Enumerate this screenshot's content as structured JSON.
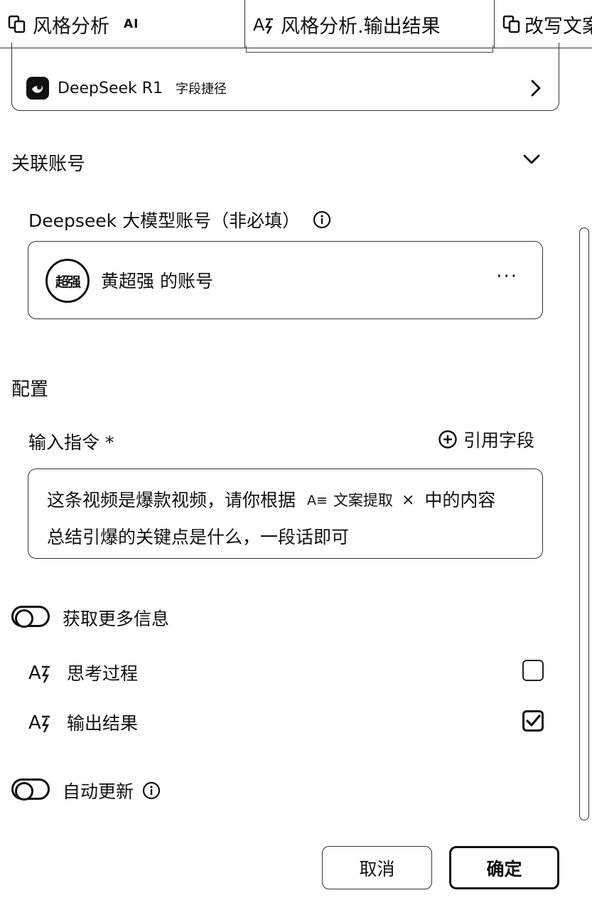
{
  "tabs": [
    {
      "label": "风格分析",
      "badge": "AI",
      "icon": "copy-icon"
    },
    {
      "label": "风格分析.输出结果",
      "icon": "ai-text-icon",
      "active": true
    },
    {
      "label": "改写文案",
      "icon": "copy-icon"
    }
  ],
  "model": {
    "name": "DeepSeek R1",
    "shortcut": "字段捷径",
    "logo": "deepseek-logo"
  },
  "linked_account": {
    "section_title": "关联账号",
    "field_label": "Deepseek 大模型账号（非必填）",
    "avatar_text": "超强",
    "account_name": "黄超强 的账号",
    "more": "···"
  },
  "config": {
    "section_title": "配置",
    "instruction_label": "输入指令 *",
    "ref_field_label": "引用字段",
    "instruction_part1": "这条视频是爆款视频，请你根据",
    "chip_icon": "A≡",
    "chip_label": "文案提取",
    "chip_close": "×",
    "instruction_part2": "中的内容",
    "instruction_line2": "总结引爆的关键点是什么，一段话即可"
  },
  "more_info": {
    "toggle_label": "获取更多信息",
    "options": [
      {
        "label": "思考过程",
        "checked": false
      },
      {
        "label": "输出结果",
        "checked": true
      }
    ]
  },
  "auto_update": {
    "label": "自动更新"
  },
  "buttons": {
    "cancel": "取消",
    "ok": "确定"
  }
}
